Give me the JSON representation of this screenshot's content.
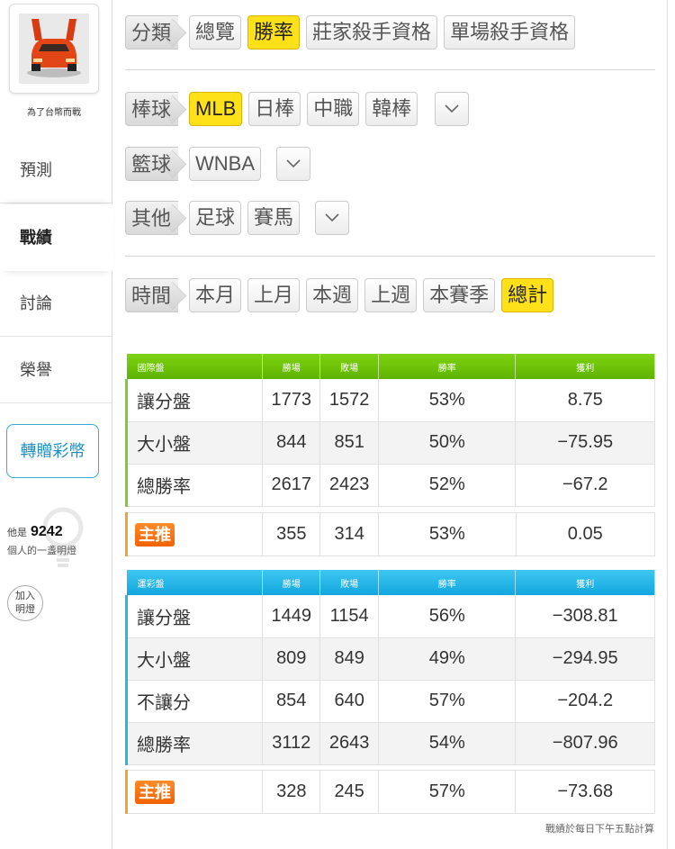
{
  "user": {
    "name": "為了台幣而戰"
  },
  "nav": {
    "predict": "預測",
    "record": "戰績",
    "discuss": "討論",
    "honor": "榮譽"
  },
  "transfer_label": "轉贈彩幣",
  "likes": {
    "prefix": "他是",
    "count": "9242",
    "suffix": "個人的一盞明燈"
  },
  "join_label": "加入明燈",
  "filters": {
    "category": {
      "label": "分類",
      "options": [
        "總覽",
        "勝率",
        "莊家殺手資格",
        "單場殺手資格"
      ],
      "selected": "勝率"
    },
    "baseball": {
      "label": "棒球",
      "options": [
        "MLB",
        "日棒",
        "中職",
        "韓棒"
      ],
      "selected": "MLB"
    },
    "basketball": {
      "label": "籃球",
      "options": [
        "WNBA"
      ]
    },
    "other": {
      "label": "其他",
      "options": [
        "足球",
        "賽馬"
      ]
    },
    "time": {
      "label": "時間",
      "options": [
        "本月",
        "上月",
        "本週",
        "上週",
        "本賽季",
        "總計"
      ],
      "selected": "總計"
    }
  },
  "table_international": {
    "title": "國際盤",
    "headers": [
      "勝場",
      "敗場",
      "勝率",
      "獲利"
    ],
    "rows": [
      [
        "讓分盤",
        "1773",
        "1572",
        "53%",
        "8.75"
      ],
      [
        "大小盤",
        "844",
        "851",
        "50%",
        "−75.95"
      ],
      [
        "總勝率",
        "2617",
        "2423",
        "52%",
        "−67.2"
      ]
    ],
    "recommend": {
      "label": "主推",
      "values": [
        "355",
        "314",
        "53%",
        "0.05"
      ]
    }
  },
  "table_sports_lottery": {
    "title": "運彩盤",
    "headers": [
      "勝場",
      "敗場",
      "勝率",
      "獲利"
    ],
    "rows": [
      [
        "讓分盤",
        "1449",
        "1154",
        "56%",
        "−308.81"
      ],
      [
        "大小盤",
        "809",
        "849",
        "49%",
        "−294.95"
      ],
      [
        "不讓分",
        "854",
        "640",
        "57%",
        "−204.2"
      ],
      [
        "總勝率",
        "3112",
        "2643",
        "54%",
        "−807.96"
      ]
    ],
    "recommend": {
      "label": "主推",
      "values": [
        "328",
        "245",
        "57%",
        "−73.68"
      ]
    }
  },
  "footnote": "戰績於每日下午五點計算",
  "colors": {
    "selected": "#ffe11a",
    "intl_header": "#6cc20a",
    "lottery_header": "#1fb0e6",
    "recommend_badge": "#f47210",
    "transfer_text": "#1d8fc4"
  }
}
